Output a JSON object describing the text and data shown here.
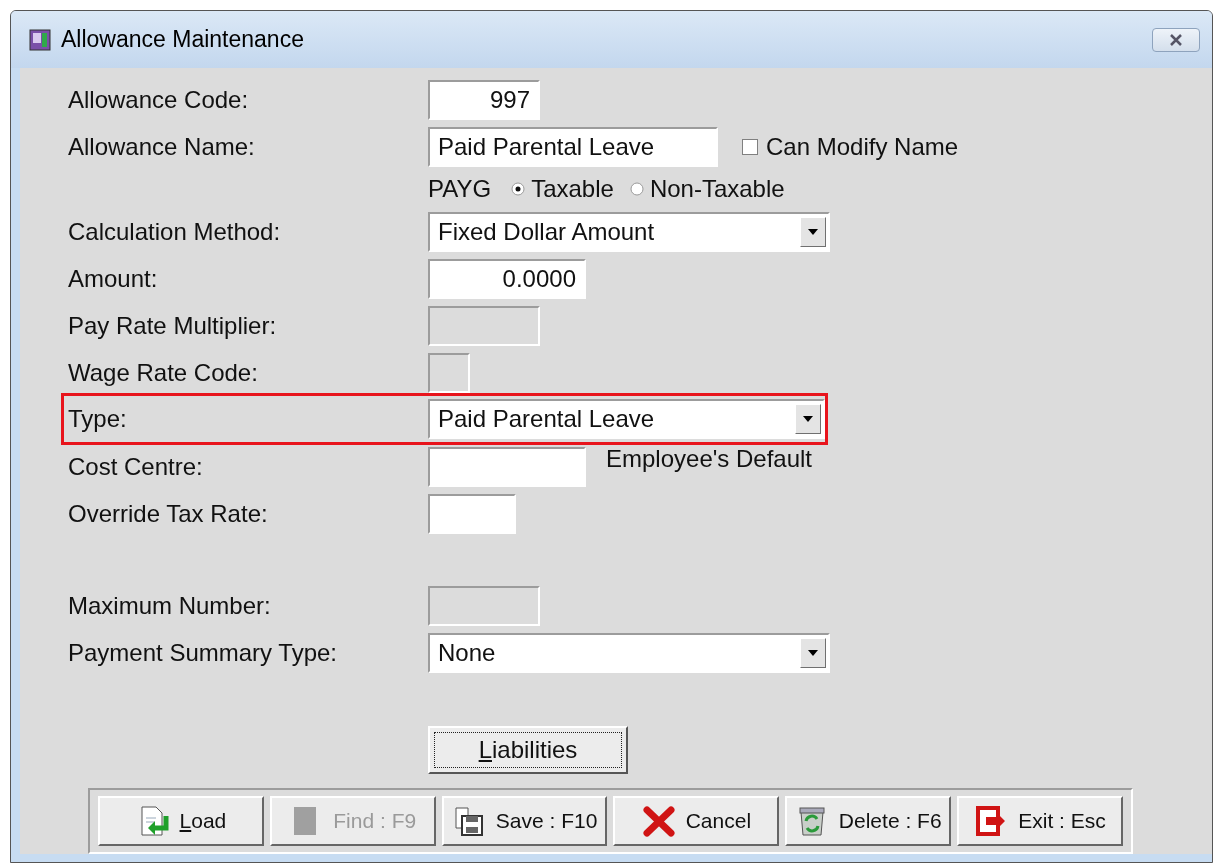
{
  "window": {
    "title": "Allowance Maintenance"
  },
  "fields": [
    {
      "kind": "number",
      "label": "Allowance Code:",
      "value": "997"
    },
    {
      "kind": "text",
      "label": "Allowance Name:",
      "value": "Paid Parental Leave",
      "checkbox": {
        "label": "Can Modify Name",
        "checked": false
      }
    },
    {
      "kind": "radio",
      "label": "PAYG",
      "options": [
        {
          "label": "Taxable",
          "selected": true
        },
        {
          "label": "Non-Taxable",
          "selected": false
        }
      ]
    },
    {
      "kind": "combo",
      "label": "Calculation Method:",
      "value": "Fixed Dollar Amount"
    },
    {
      "kind": "number",
      "label": "Amount:",
      "value": "0.0000"
    },
    {
      "kind": "text",
      "label": "Pay Rate Multiplier:",
      "disabled": true
    },
    {
      "kind": "text",
      "label": "Wage Rate Code:",
      "disabled": true
    },
    {
      "kind": "combo",
      "label": "Type:",
      "value": "Paid Parental Leave",
      "highlighted": true
    },
    {
      "kind": "text",
      "label": "Cost Centre:",
      "note": "Employee's Default"
    },
    {
      "kind": "text",
      "label": "Override Tax Rate:"
    },
    {
      "kind": "spacer"
    },
    {
      "kind": "text",
      "label": "Maximum Number:",
      "disabled": true
    },
    {
      "kind": "combo",
      "label": "Payment Summary Type:",
      "value": "None"
    }
  ],
  "liabilities_button": {
    "label": "Liabilities",
    "underline_first": true,
    "focused": true
  },
  "toolbar": [
    {
      "label": "Load",
      "underline_first": true,
      "disabled": false
    },
    {
      "label": "Find : F9",
      "disabled": true
    },
    {
      "label": "Save : F10",
      "disabled": false
    },
    {
      "label": "Cancel",
      "disabled": false
    },
    {
      "label": "Delete : F6",
      "disabled": false
    },
    {
      "label": "Exit : Esc",
      "disabled": false
    }
  ]
}
